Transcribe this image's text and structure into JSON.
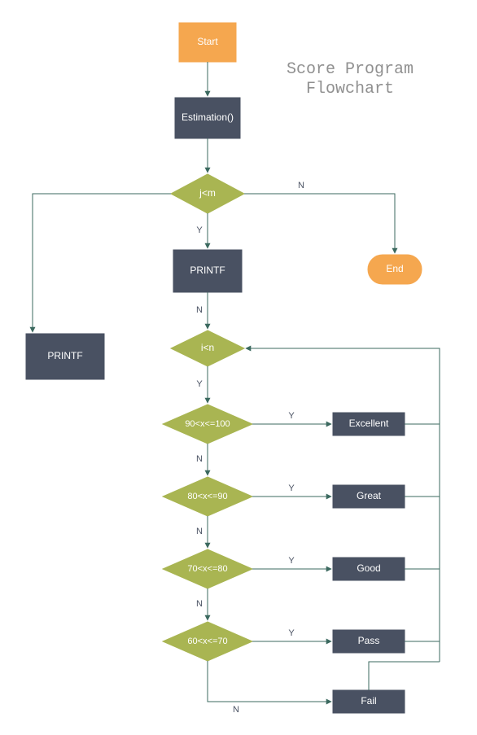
{
  "title": {
    "line1": "Score Program",
    "line2": "Flowchart"
  },
  "nodes": {
    "start": "Start",
    "estimation": "Estimation()",
    "jm": "j<m",
    "printf1": "PRINTF",
    "printf2": "PRINTF",
    "in": "i<n",
    "c90": "90<x<=100",
    "c80": "80<x<=90",
    "c70": "70<x<=80",
    "c60": "60<x<=70",
    "excellent": "Excellent",
    "great": "Great",
    "good": "Good",
    "pass": "Pass",
    "fail": "Fail",
    "end": "End"
  },
  "labels": {
    "Y": "Y",
    "N": "N"
  }
}
